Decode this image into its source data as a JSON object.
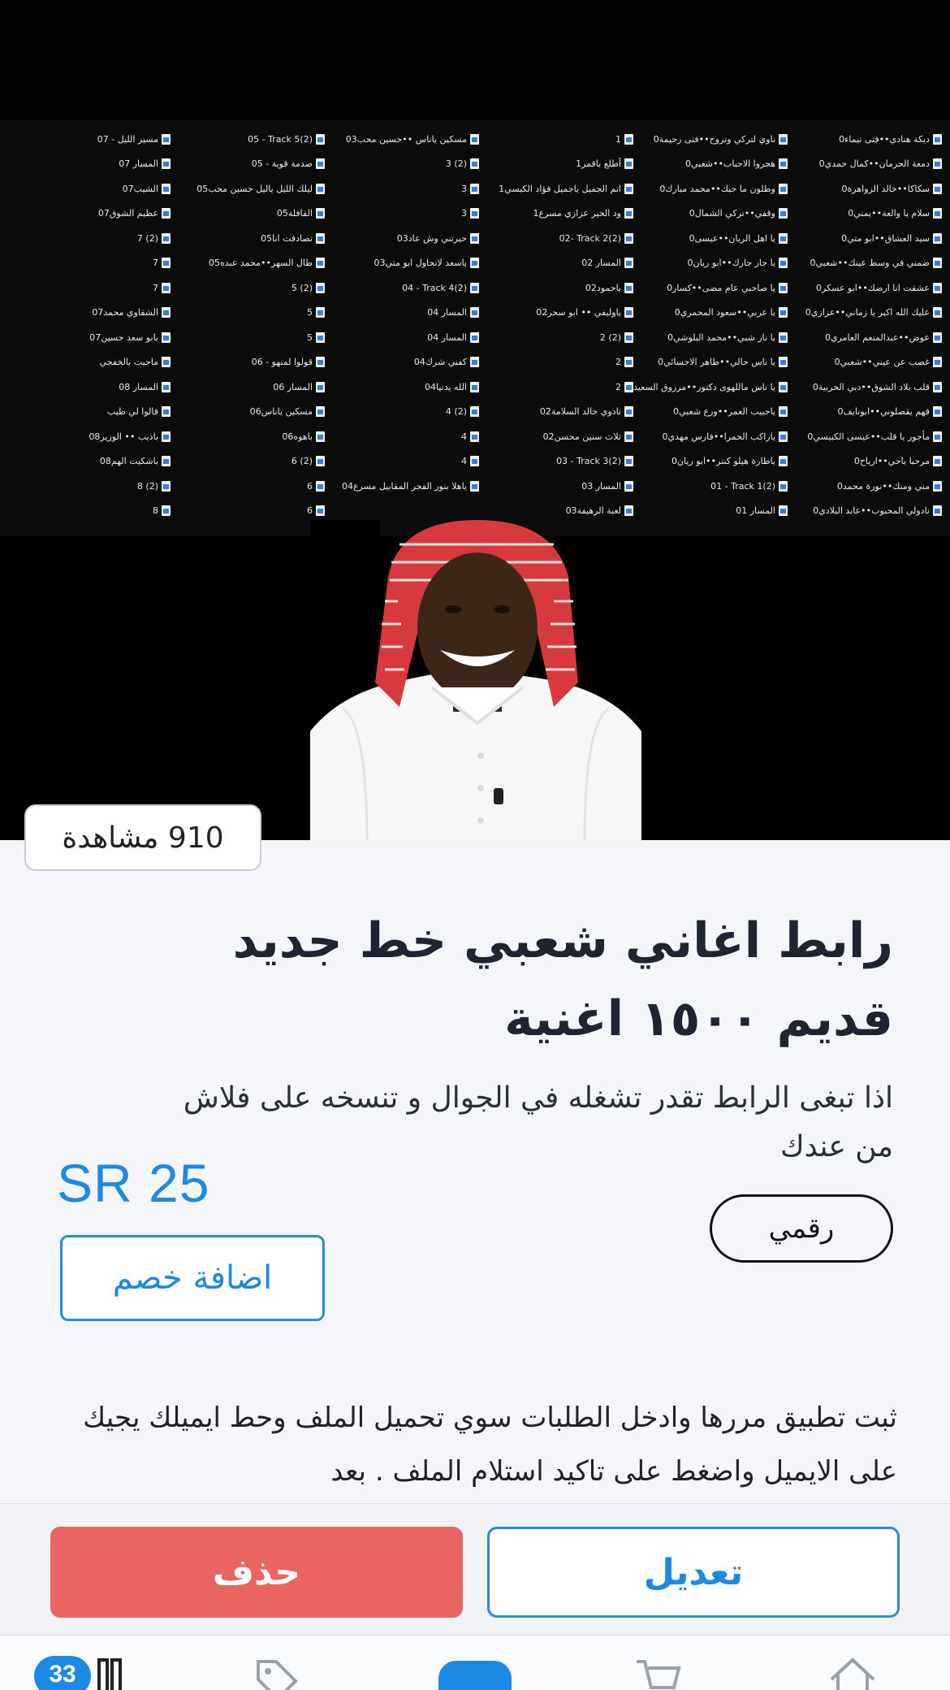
{
  "hero": {
    "file_columns": [
      [
        "0ديكة هنادي••فتى تيماء",
        "0دمعة الحرمان••كمال حمدي",
        "0سكاكا••خالد الزواهرة",
        "0سلام يا والعة••يمني",
        "0سيد العشاق••ابو متي",
        "0ضمني في وسط عينك••شعبي",
        "0عشقت انا ارضك••ابو عسكر",
        "0عليك الله اكبر يا زماني••عزازي",
        "0عوض••عبدالمنعم العامري",
        "0غصب عن عيني••شعبي",
        "0قلب بلاد الشوق••دبي الحربية",
        "0فهم يقصلوني••ابونايف",
        "0مأجور يا قلب••عيسى الكبيسي",
        "0مرحبا ياحي••ارياح",
        "0مني ومنك••نورة محمد",
        "0نادولي المحبوب••عابد البلادي"
      ],
      [
        "0ناوي لتركي وتروح••فتى رحيمة",
        "0هجروا الاحباب••شعبي",
        "0وطلون ما حبك••محمد مبارك",
        "0وقفي••تركي الشمال",
        "0يا اهل الريان••عيسى",
        "0يا جار جارك••ابو ريان",
        "0يا صاحبي عام مضى••كسار",
        "0يا عربي••سعود المحمري",
        "0يا نار شبي••محمد البلوشي",
        "0يا ناس حالي••طاهر الاحسائي",
        "0يا ناس ماللهوى دكتور••مرزوق السعيد",
        "0ياحبيب العمر••ورع شعبي",
        "0ياراكب الحمرا••فارس مهدي",
        "0ياطارة هيلو كنتر••ابو ريان",
        "01 - Track 1(2)",
        "المسار 01"
      ],
      [
        "1",
        "1أطلع باقمر",
        "1اتم الجميل ياجميل فؤاد الكبسي",
        "1ود الخير عزازي مسرع",
        "02- Track 2(2)",
        "المسار 02",
        "02ياحمود",
        "02ياوليفي •• ابو سحر",
        "2 (2)",
        "2",
        "2",
        "02نادوي خالد السلامة",
        "02ثلاث سنين محسن",
        "03 - Track 3(2)",
        "المسار 03",
        "03لعبة الرهيفة"
      ],
      [
        "03مسكين ياناس ••حسين محب",
        "3 (2)",
        "3",
        "3",
        "03حيرتني وش عاد",
        "03ياسعد لاتحاول ابو متي",
        "04 - Track 4(2)",
        "المسار 04",
        "المسار 04",
        "04كفني شرك",
        "04الله يدنيا",
        "4 (2)",
        "4",
        "4",
        "04ياهلا بنور الفجر المقابيل مسرع",
        ""
      ],
      [
        "05 - Track 5(2)",
        "صدمة قوية - 05",
        "05ليلك الليل ياليل حسين محب",
        "05القافلة",
        "05تصادفت انا",
        "05طال السهر••محمد عبده",
        "5 (2)",
        "5",
        "5",
        "قولوا لمنهو - 06",
        "المسار 06",
        "06مسكين ياناس",
        "06باهوه",
        "6 (2)",
        "6",
        "6"
      ],
      [
        "مسير الليل - 07",
        "المسار 07",
        "07الشيب",
        "07عظيم الشوق",
        "7 (2)",
        "7",
        "7",
        "07الشقاوي محمد",
        "07بابو سعد حسين",
        "ماجيت بالخفجي",
        "المسار 08",
        "قالوا لي طيب",
        "08باذيب •• الوزير",
        "08باشكيت الهم",
        "8 (2)",
        "8"
      ]
    ]
  },
  "views_badge": "910 مشاهدة",
  "title": "رابط اغاني شعبي خط جديد قديم ١٥٠٠ اغنية",
  "description": "اذا تبغى الرابط تقدر تشغله في الجوال و تنسخه على فلاش من عندك",
  "price": "SR 25",
  "product_type": "رقمي",
  "discount_button": "اضافة خصم",
  "long_description": "ثبت تطبيق مررها وادخل الطلبات سوي تحميل الملف وحط ايميلك يجيك على الايميل واضغط على تاكيد استلام الملف . بعد",
  "actions": {
    "delete_label": "حذف",
    "edit_label": "تعديل"
  },
  "tab_bar": {
    "orders_badge": "33"
  },
  "colors": {
    "accent": "#1e88e5",
    "danger": "#e96562",
    "background": "#f4f6f9"
  }
}
